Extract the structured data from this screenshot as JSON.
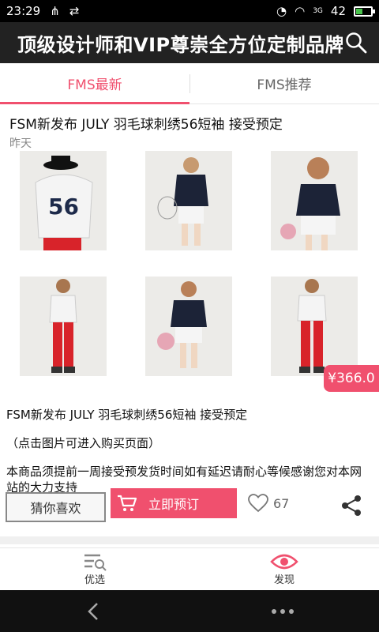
{
  "status": {
    "time": "23:29",
    "signal": "3G",
    "battery": "42",
    "battery_level": 0.42
  },
  "app": {
    "title": "顶级设计师和VIP尊崇全方位定制品牌"
  },
  "tabs": [
    {
      "label": "FMS最新"
    },
    {
      "label": "FMS推荐"
    }
  ],
  "post": {
    "title": "FSM新发布 JULY 羽毛球刺绣56短袖 接受预定",
    "date": "昨天",
    "price": "¥366.0",
    "desc_title": "FSM新发布 JULY 羽毛球刺绣56短袖 接受预定",
    "hint": "（点击图片可进入购买页面）",
    "notice": "本商品须提前一周接受预发货时间如有延迟请耐心等候感谢您对本网站的大力支持"
  },
  "actions": {
    "guess": "猜你喜欢",
    "order": "立即预订",
    "likes": "67"
  },
  "bottomnav": [
    {
      "label": "优选"
    },
    {
      "label": "发现"
    }
  ],
  "colors": {
    "accent": "#f0506e",
    "appbar": "#222222"
  }
}
